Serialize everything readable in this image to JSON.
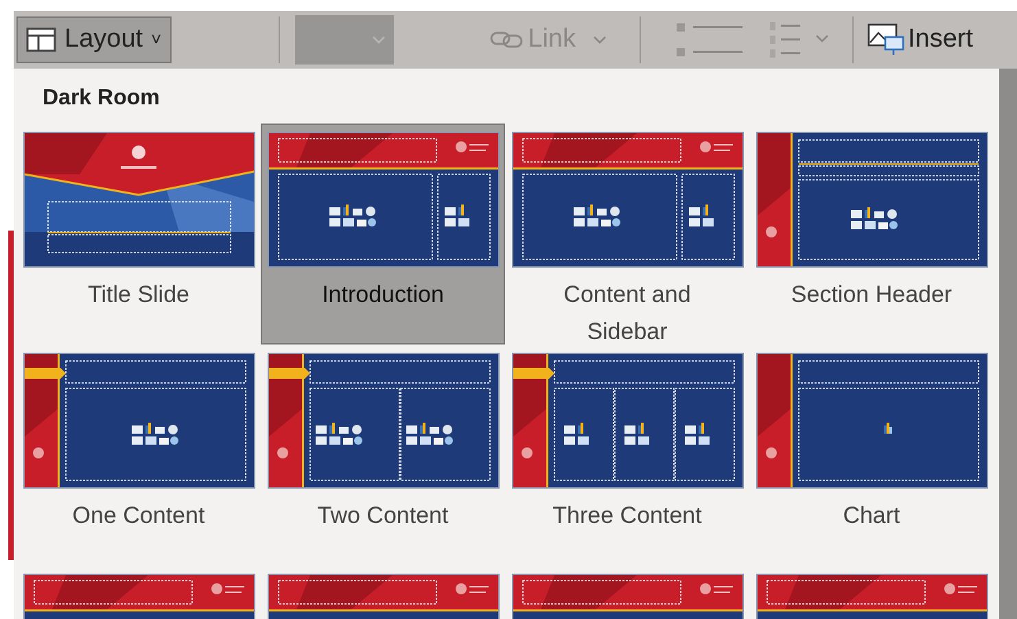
{
  "toolbar": {
    "layout_button": {
      "label": "Layout",
      "caret": "˅"
    },
    "style_dropdown": {
      "disabled": true
    },
    "link_button": {
      "label": "Link"
    },
    "insert_button": {
      "label": "Insert"
    }
  },
  "gallery": {
    "title": "Dark Room",
    "layouts": [
      {
        "kind": "title",
        "label": "Title Slide",
        "selected": false
      },
      {
        "kind": "content-sidebar",
        "label": "Introduction",
        "selected": true
      },
      {
        "kind": "content-sidebar",
        "label": "Content and Sidebar",
        "selected": false
      },
      {
        "kind": "section",
        "label": "Section Header",
        "selected": false
      },
      {
        "kind": "one",
        "label": "One Content",
        "selected": false
      },
      {
        "kind": "two",
        "label": "Two Content",
        "selected": false
      },
      {
        "kind": "three",
        "label": "Three Content",
        "selected": false
      },
      {
        "kind": "chart",
        "label": "Chart",
        "selected": false
      },
      {
        "kind": "banner",
        "selected": false
      },
      {
        "kind": "banner",
        "selected": false
      },
      {
        "kind": "banner",
        "selected": false
      },
      {
        "kind": "banner",
        "selected": false
      }
    ]
  }
}
